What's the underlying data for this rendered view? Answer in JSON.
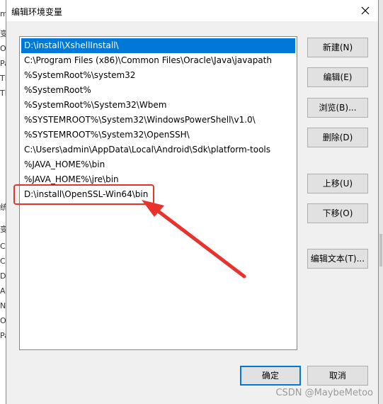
{
  "background": {
    "left_fragments": [
      "m",
      "变",
      "O",
      "Pa",
      "TE",
      "TN",
      "统",
      "变",
      "CL",
      "Co",
      "Di",
      "A",
      "NI",
      "O",
      "Pa"
    ]
  },
  "dialog": {
    "title": "编辑环境变量",
    "close_label": "×"
  },
  "path_list": {
    "items": [
      {
        "text": "D:\\install\\XshellInstall\\",
        "selected": true
      },
      {
        "text": "C:\\Program Files (x86)\\Common Files\\Oracle\\Java\\javapath",
        "selected": false
      },
      {
        "text": "%SystemRoot%\\system32",
        "selected": false
      },
      {
        "text": "%SystemRoot%",
        "selected": false
      },
      {
        "text": "%SystemRoot%\\System32\\Wbem",
        "selected": false
      },
      {
        "text": "%SYSTEMROOT%\\System32\\WindowsPowerShell\\v1.0\\",
        "selected": false
      },
      {
        "text": "%SYSTEMROOT%\\System32\\OpenSSH\\",
        "selected": false
      },
      {
        "text": "C:\\Users\\admin\\AppData\\Local\\Android\\Sdk\\platform-tools",
        "selected": false
      },
      {
        "text": "%JAVA_HOME%\\bin",
        "selected": false
      },
      {
        "text": "%JAVA_HOME%\\jre\\bin",
        "selected": false
      },
      {
        "text": "D:\\install\\OpenSSL-Win64\\bin",
        "selected": false
      }
    ]
  },
  "buttons": {
    "new": "新建(N)",
    "edit": "编辑(E)",
    "browse": "浏览(B)...",
    "delete": "删除(D)",
    "move_up": "上移(U)",
    "move_down": "下移(O)",
    "edit_text": "编辑文本(T)...",
    "ok": "确定",
    "cancel": "取消"
  },
  "colors": {
    "selection": "#0078d7",
    "annotation": "#e8322b"
  },
  "watermark": "CSDN @MaybeMetoo"
}
